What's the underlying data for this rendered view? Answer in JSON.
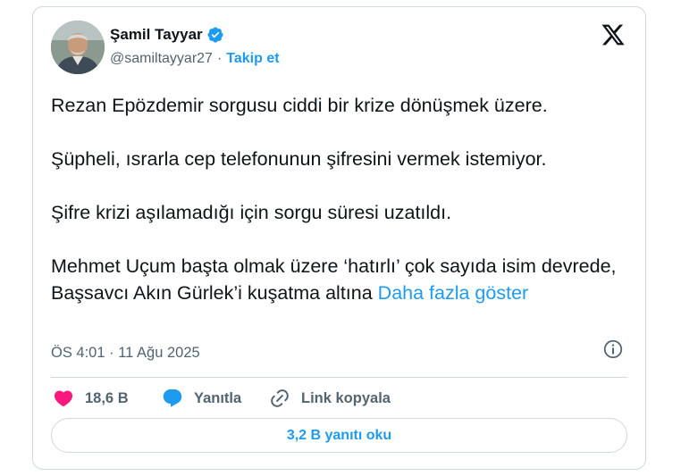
{
  "author": {
    "name": "Şamil Tayyar",
    "handle": "@samiltayyar27",
    "separator": "·",
    "follow_label": "Takip et",
    "verified_icon": "verified-badge-icon",
    "verified_color": "#1d9bf0"
  },
  "platform_icon": "x-logo-icon",
  "tweet": {
    "paragraphs": [
      "Rezan Epözdemir sorgusu ciddi bir krize dönüşmek üzere.",
      "Şüpheli, ısrarla cep telefonunun şifresini vermek istemiyor.",
      "Şifre krizi aşılamadığı için sorgu süresi uzatıldı.",
      "Mehmet Uçum başta olmak üzere ‘hatırlı’ çok sayıda isim devrede, Başsavcı Akın Gürlek’i kuşatma altına"
    ],
    "show_more_label": "Daha fazla göster"
  },
  "meta": {
    "time": "ÖS 4:01",
    "separator": "·",
    "date": "11 Ağu 2025",
    "info_icon": "info-icon"
  },
  "actions": {
    "likes": {
      "count": "18,6 B",
      "icon": "heart-icon",
      "color": "#f91880"
    },
    "reply": {
      "label": "Yanıtla",
      "icon": "reply-bubble-icon",
      "color": "#1d9bf0"
    },
    "copy_link": {
      "label": "Link kopyala",
      "icon": "link-icon"
    }
  },
  "read_replies": {
    "label": "3,2 B yanıtı oku"
  },
  "colors": {
    "accent": "#1d9bf0",
    "text": "#0f1419",
    "secondary": "#536471",
    "border": "#cfd9de"
  }
}
